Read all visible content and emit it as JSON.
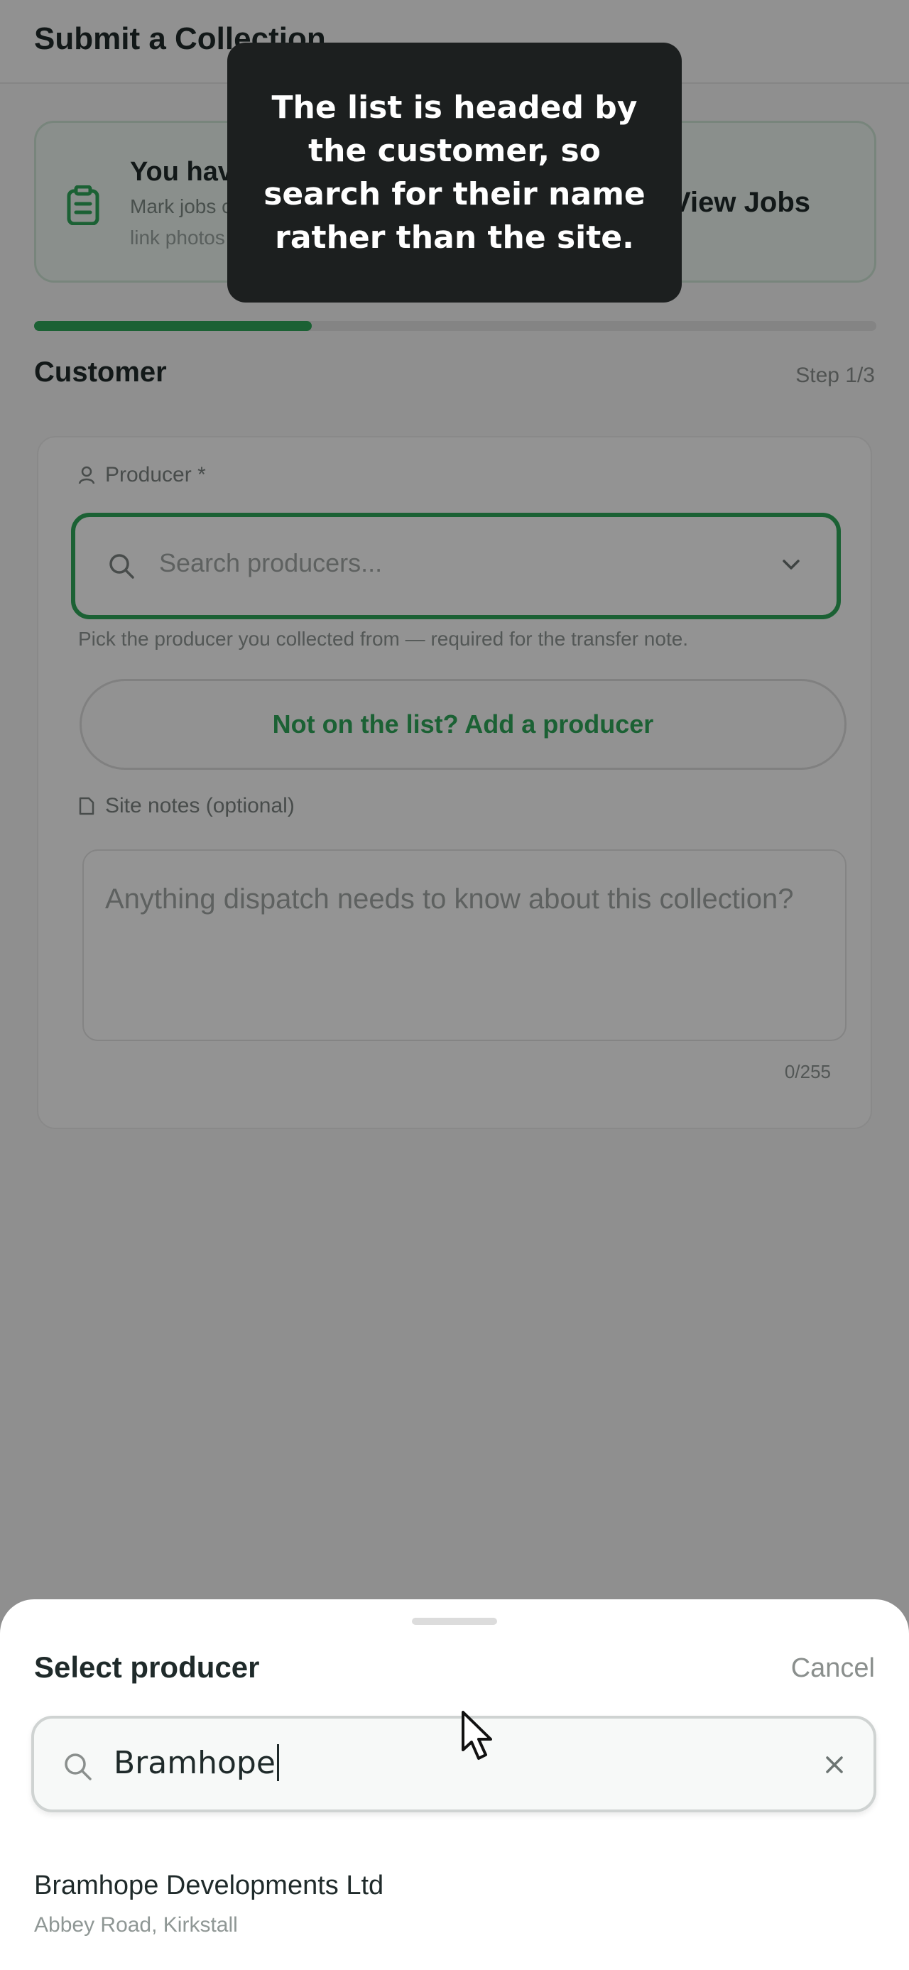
{
  "page": {
    "title": "Submit a Collection",
    "jobs_banner": {
      "title": "You have jobs assigned",
      "subtitle": "Mark jobs complete and",
      "subtitle2": "link photos",
      "view_jobs_label": "View Jobs",
      "icon": "clipboard-icon"
    },
    "progress": {
      "fraction": 0.33
    },
    "section_title": "Customer",
    "step_label": "Step 1/3",
    "form": {
      "producer_label": "Producer *",
      "producer_placeholder": "Search producers...",
      "producer_helper": "Pick the producer you collected from — required for the transfer note.",
      "add_producer_label": "Not on the list? Add a producer",
      "notes_label": "Site notes (optional)",
      "notes_placeholder": "Anything dispatch needs to know about this collection?",
      "notes_counter": "0/255"
    }
  },
  "tooltip": {
    "text": "The list is headed by the customer, so search for their name rather than the site."
  },
  "sheet": {
    "title": "Select producer",
    "cancel_label": "Cancel",
    "search_value": "Bramhope",
    "results": [
      {
        "name": "Bramhope Developments Ltd",
        "address": "Abbey Road, Kirkstall"
      }
    ]
  },
  "colors": {
    "accent": "#2fa85a",
    "tooltip_bg": "#1c1f1f",
    "dim_overlay": "rgba(0,0,0,0.42)"
  }
}
